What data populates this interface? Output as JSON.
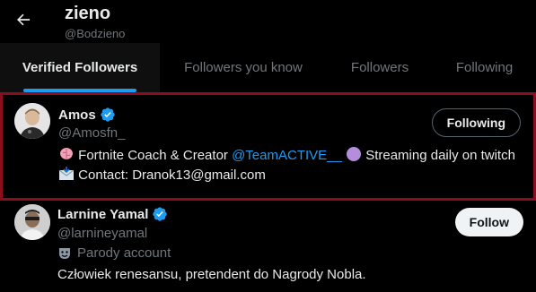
{
  "header": {
    "title": "zieno",
    "handle": "@Bodzieno"
  },
  "tabs": [
    {
      "label": "Verified Followers",
      "active": true
    },
    {
      "label": "Followers you know",
      "active": false
    },
    {
      "label": "Followers",
      "active": false
    },
    {
      "label": "Following",
      "active": false
    }
  ],
  "users": [
    {
      "name": "Amos",
      "handle": "@Amosfn_",
      "verified": true,
      "button_label": "Following",
      "bio_line1_a": "Fortnite Coach & Creator ",
      "bio_line1_mention": "@TeamACTIVE__",
      "bio_line1_b": " Streaming daily on twitch",
      "bio_line2": "Contact: Dranok13@gmail.com",
      "icons": [
        "brain-emoji-icon",
        "purple-circle-emoji-icon",
        "envelope-emoji-icon"
      ]
    },
    {
      "name": "Larnine Yamal",
      "handle": "@larnineyamal",
      "verified": true,
      "button_label": "Follow",
      "parody_label": "Parody account",
      "bio": "Człowiek renesansu, pretendent do Nagrody Nobla."
    }
  ],
  "colors": {
    "accent": "#1d9bf0",
    "highlight_border": "#8b0e1e",
    "secondary_text": "#71767b"
  }
}
